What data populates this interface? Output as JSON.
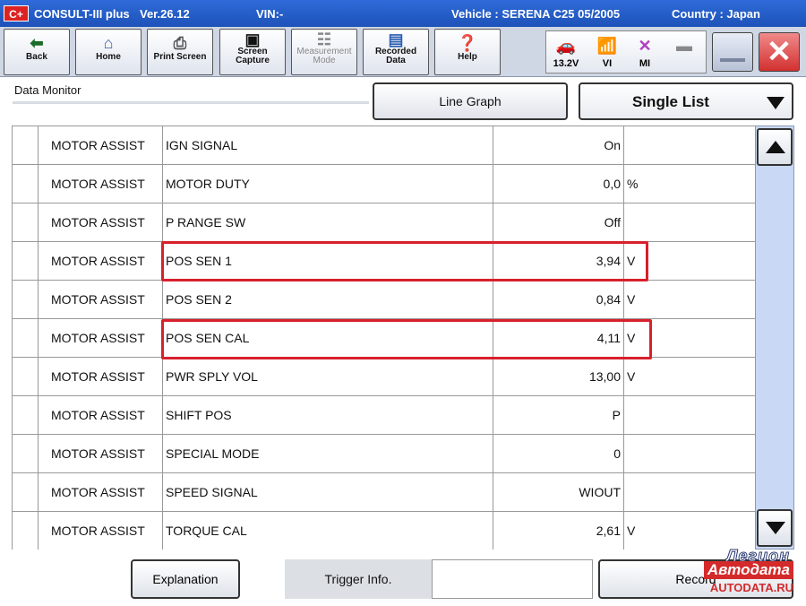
{
  "titlebar": {
    "logo": "C+",
    "app": "CONSULT-III plus",
    "version": "Ver.26.12",
    "vin": "VIN:-",
    "vehicle": "Vehicle : SERENA C25 05/2005",
    "country": "Country : Japan"
  },
  "toolbar": {
    "back": "Back",
    "home": "Home",
    "print_screen": "Print Screen",
    "screen_capture_1": "Screen",
    "screen_capture_2": "Capture",
    "measurement_1": "Measurement",
    "measurement_2": "Mode",
    "recorded_1": "Recorded",
    "recorded_2": "Data",
    "help": "Help",
    "voltage": "13.2V",
    "vi": "VI",
    "mi": "MI"
  },
  "header": {
    "title": "Data Monitor",
    "line_graph": "Line Graph",
    "view_mode": "Single List"
  },
  "table": {
    "rows": [
      {
        "system": "MOTOR ASSIST",
        "item": "IGN SIGNAL",
        "value": "On",
        "unit": ""
      },
      {
        "system": "MOTOR ASSIST",
        "item": "MOTOR DUTY",
        "value": "0,0",
        "unit": "%"
      },
      {
        "system": "MOTOR ASSIST",
        "item": "P RANGE SW",
        "value": "Off",
        "unit": ""
      },
      {
        "system": "MOTOR ASSIST",
        "item": "POS SEN 1",
        "value": "3,94",
        "unit": "V"
      },
      {
        "system": "MOTOR ASSIST",
        "item": "POS SEN 2",
        "value": "0,84",
        "unit": "V"
      },
      {
        "system": "MOTOR ASSIST",
        "item": "POS SEN CAL",
        "value": "4,11",
        "unit": "V"
      },
      {
        "system": "MOTOR ASSIST",
        "item": "PWR SPLY VOL",
        "value": "13,00",
        "unit": "V"
      },
      {
        "system": "MOTOR ASSIST",
        "item": "SHIFT POS",
        "value": "P",
        "unit": ""
      },
      {
        "system": "MOTOR ASSIST",
        "item": "SPECIAL MODE",
        "value": "0",
        "unit": ""
      },
      {
        "system": "MOTOR ASSIST",
        "item": "SPEED SIGNAL",
        "value": "WIOUT",
        "unit": ""
      },
      {
        "system": "MOTOR ASSIST",
        "item": "TORQUE CAL",
        "value": "2,61",
        "unit": "V"
      }
    ]
  },
  "bottom": {
    "explanation": "Explanation",
    "trigger_info": "Trigger Info.",
    "trigger_value": "",
    "record": "Record"
  },
  "watermark": {
    "line1": "Легион",
    "line2": "Автодата",
    "line3": "AUTODATA.RU"
  },
  "colors": {
    "titlebar": "#1d52b8",
    "highlight": "#d8202c",
    "scroll_track": "#c9d8f4"
  },
  "icons": {
    "back": "arrow-left-icon",
    "home": "house-icon",
    "print": "printer-icon",
    "capture": "camera-icon",
    "measurement": "clipboard-icon",
    "recorded": "folders-icon",
    "help": "question-icon",
    "battery": "car-battery-icon",
    "vi": "antenna-signal-icon",
    "mi": "cross-icon"
  }
}
